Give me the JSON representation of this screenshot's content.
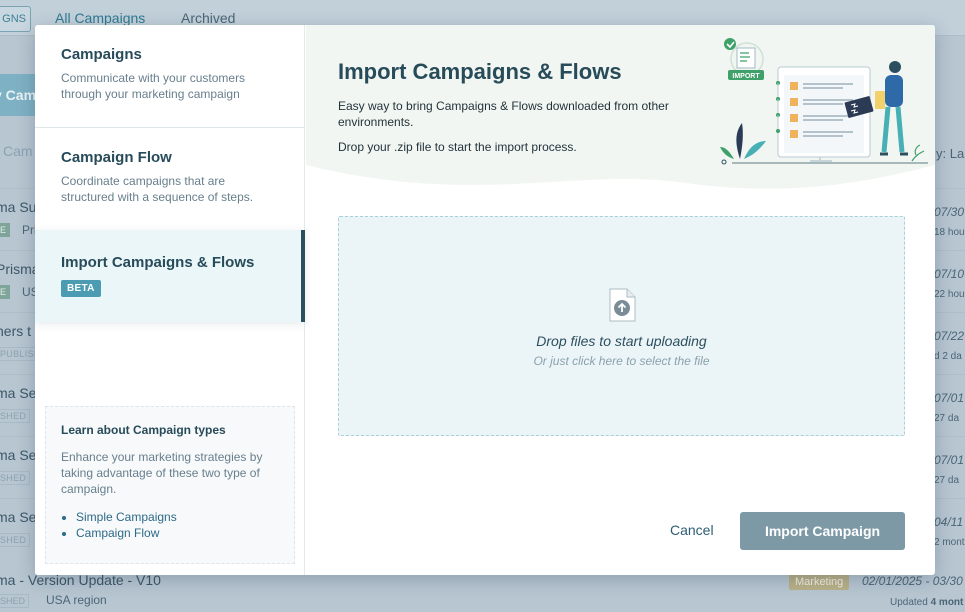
{
  "background": {
    "chip_label": "GNS",
    "tabs": [
      "All Campaigns",
      "Archived"
    ],
    "cta_label": "y Cam",
    "search_label": "Cam",
    "sort_label": "y:   La",
    "rows": [
      {
        "name": "ma Su",
        "tag": "E",
        "sub": "Pri",
        "date": "07/30",
        "updated": "18 hou"
      },
      {
        "name": "Prisma",
        "tag": "E",
        "sub": "US",
        "date": "07/10",
        "updated": "22 hou"
      },
      {
        "name": "ners t",
        "tag": "PUBLISH",
        "sub": "",
        "date": "07/22",
        "updated": "d 2 da"
      },
      {
        "name": "ma Se",
        "tag": "SHED",
        "sub": "",
        "date": "07/01",
        "updated": "27 da"
      },
      {
        "name": "ma Se",
        "tag": "SHED",
        "sub": "",
        "date": "07/01",
        "updated": "27 da"
      },
      {
        "name": "ma Se",
        "tag": "SHED",
        "sub": "",
        "date": "04/11",
        "updated": "2 mont"
      }
    ],
    "bottom_row": {
      "name": "ma - Version Update - V10",
      "tag": "SHED",
      "sub": "USA region",
      "badge": "Marketing",
      "date": "02/01/2025 - 03/30",
      "updated_prefix": "Updated ",
      "updated_value": "4 mont"
    }
  },
  "sidebar": {
    "items": [
      {
        "title": "Campaigns",
        "description": "Communicate with your customers through your marketing campaign"
      },
      {
        "title": "Campaign Flow",
        "description": "Coordinate campaigns that are structured with a sequence of steps."
      },
      {
        "title": "Import Campaigns & Flows",
        "badge": "BETA"
      }
    ],
    "learn": {
      "title": "Learn about Campaign types",
      "description": "Enhance your marketing strategies by taking advantage of these two type of campaign.",
      "links": [
        "Simple Campaigns",
        "Campaign Flow"
      ]
    }
  },
  "main": {
    "title": "Import Campaigns & Flows",
    "description": "Easy way to bring Campaigns & Flows downloaded from other environments.",
    "instruction": "Drop your .zip file to start the import process.",
    "illustration_badge": "IMPORT",
    "dropzone": {
      "title": "Drop files to start uploading",
      "subtitle": "Or just click here to select the file"
    },
    "cancel_label": "Cancel",
    "import_label": "Import Campaign"
  },
  "colors": {
    "accent": "#4b9bb3",
    "primary_text": "#284b5a",
    "button_disabled": "#7d99a6",
    "dropzone_bg": "#ebf4f6"
  }
}
